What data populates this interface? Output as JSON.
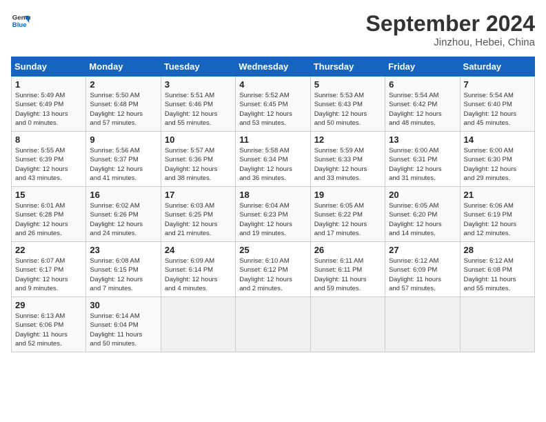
{
  "header": {
    "logo_line1": "General",
    "logo_line2": "Blue",
    "month": "September 2024",
    "location": "Jinzhou, Hebei, China"
  },
  "weekdays": [
    "Sunday",
    "Monday",
    "Tuesday",
    "Wednesday",
    "Thursday",
    "Friday",
    "Saturday"
  ],
  "weeks": [
    [
      {
        "day": "1",
        "info": "Sunrise: 5:49 AM\nSunset: 6:49 PM\nDaylight: 13 hours\nand 0 minutes."
      },
      {
        "day": "2",
        "info": "Sunrise: 5:50 AM\nSunset: 6:48 PM\nDaylight: 12 hours\nand 57 minutes."
      },
      {
        "day": "3",
        "info": "Sunrise: 5:51 AM\nSunset: 6:46 PM\nDaylight: 12 hours\nand 55 minutes."
      },
      {
        "day": "4",
        "info": "Sunrise: 5:52 AM\nSunset: 6:45 PM\nDaylight: 12 hours\nand 53 minutes."
      },
      {
        "day": "5",
        "info": "Sunrise: 5:53 AM\nSunset: 6:43 PM\nDaylight: 12 hours\nand 50 minutes."
      },
      {
        "day": "6",
        "info": "Sunrise: 5:54 AM\nSunset: 6:42 PM\nDaylight: 12 hours\nand 48 minutes."
      },
      {
        "day": "7",
        "info": "Sunrise: 5:54 AM\nSunset: 6:40 PM\nDaylight: 12 hours\nand 45 minutes."
      }
    ],
    [
      {
        "day": "8",
        "info": "Sunrise: 5:55 AM\nSunset: 6:39 PM\nDaylight: 12 hours\nand 43 minutes."
      },
      {
        "day": "9",
        "info": "Sunrise: 5:56 AM\nSunset: 6:37 PM\nDaylight: 12 hours\nand 41 minutes."
      },
      {
        "day": "10",
        "info": "Sunrise: 5:57 AM\nSunset: 6:36 PM\nDaylight: 12 hours\nand 38 minutes."
      },
      {
        "day": "11",
        "info": "Sunrise: 5:58 AM\nSunset: 6:34 PM\nDaylight: 12 hours\nand 36 minutes."
      },
      {
        "day": "12",
        "info": "Sunrise: 5:59 AM\nSunset: 6:33 PM\nDaylight: 12 hours\nand 33 minutes."
      },
      {
        "day": "13",
        "info": "Sunrise: 6:00 AM\nSunset: 6:31 PM\nDaylight: 12 hours\nand 31 minutes."
      },
      {
        "day": "14",
        "info": "Sunrise: 6:00 AM\nSunset: 6:30 PM\nDaylight: 12 hours\nand 29 minutes."
      }
    ],
    [
      {
        "day": "15",
        "info": "Sunrise: 6:01 AM\nSunset: 6:28 PM\nDaylight: 12 hours\nand 26 minutes."
      },
      {
        "day": "16",
        "info": "Sunrise: 6:02 AM\nSunset: 6:26 PM\nDaylight: 12 hours\nand 24 minutes."
      },
      {
        "day": "17",
        "info": "Sunrise: 6:03 AM\nSunset: 6:25 PM\nDaylight: 12 hours\nand 21 minutes."
      },
      {
        "day": "18",
        "info": "Sunrise: 6:04 AM\nSunset: 6:23 PM\nDaylight: 12 hours\nand 19 minutes."
      },
      {
        "day": "19",
        "info": "Sunrise: 6:05 AM\nSunset: 6:22 PM\nDaylight: 12 hours\nand 17 minutes."
      },
      {
        "day": "20",
        "info": "Sunrise: 6:05 AM\nSunset: 6:20 PM\nDaylight: 12 hours\nand 14 minutes."
      },
      {
        "day": "21",
        "info": "Sunrise: 6:06 AM\nSunset: 6:19 PM\nDaylight: 12 hours\nand 12 minutes."
      }
    ],
    [
      {
        "day": "22",
        "info": "Sunrise: 6:07 AM\nSunset: 6:17 PM\nDaylight: 12 hours\nand 9 minutes."
      },
      {
        "day": "23",
        "info": "Sunrise: 6:08 AM\nSunset: 6:15 PM\nDaylight: 12 hours\nand 7 minutes."
      },
      {
        "day": "24",
        "info": "Sunrise: 6:09 AM\nSunset: 6:14 PM\nDaylight: 12 hours\nand 4 minutes."
      },
      {
        "day": "25",
        "info": "Sunrise: 6:10 AM\nSunset: 6:12 PM\nDaylight: 12 hours\nand 2 minutes."
      },
      {
        "day": "26",
        "info": "Sunrise: 6:11 AM\nSunset: 6:11 PM\nDaylight: 11 hours\nand 59 minutes."
      },
      {
        "day": "27",
        "info": "Sunrise: 6:12 AM\nSunset: 6:09 PM\nDaylight: 11 hours\nand 57 minutes."
      },
      {
        "day": "28",
        "info": "Sunrise: 6:12 AM\nSunset: 6:08 PM\nDaylight: 11 hours\nand 55 minutes."
      }
    ],
    [
      {
        "day": "29",
        "info": "Sunrise: 6:13 AM\nSunset: 6:06 PM\nDaylight: 11 hours\nand 52 minutes."
      },
      {
        "day": "30",
        "info": "Sunrise: 6:14 AM\nSunset: 6:04 PM\nDaylight: 11 hours\nand 50 minutes."
      },
      {
        "day": "",
        "info": ""
      },
      {
        "day": "",
        "info": ""
      },
      {
        "day": "",
        "info": ""
      },
      {
        "day": "",
        "info": ""
      },
      {
        "day": "",
        "info": ""
      }
    ]
  ]
}
